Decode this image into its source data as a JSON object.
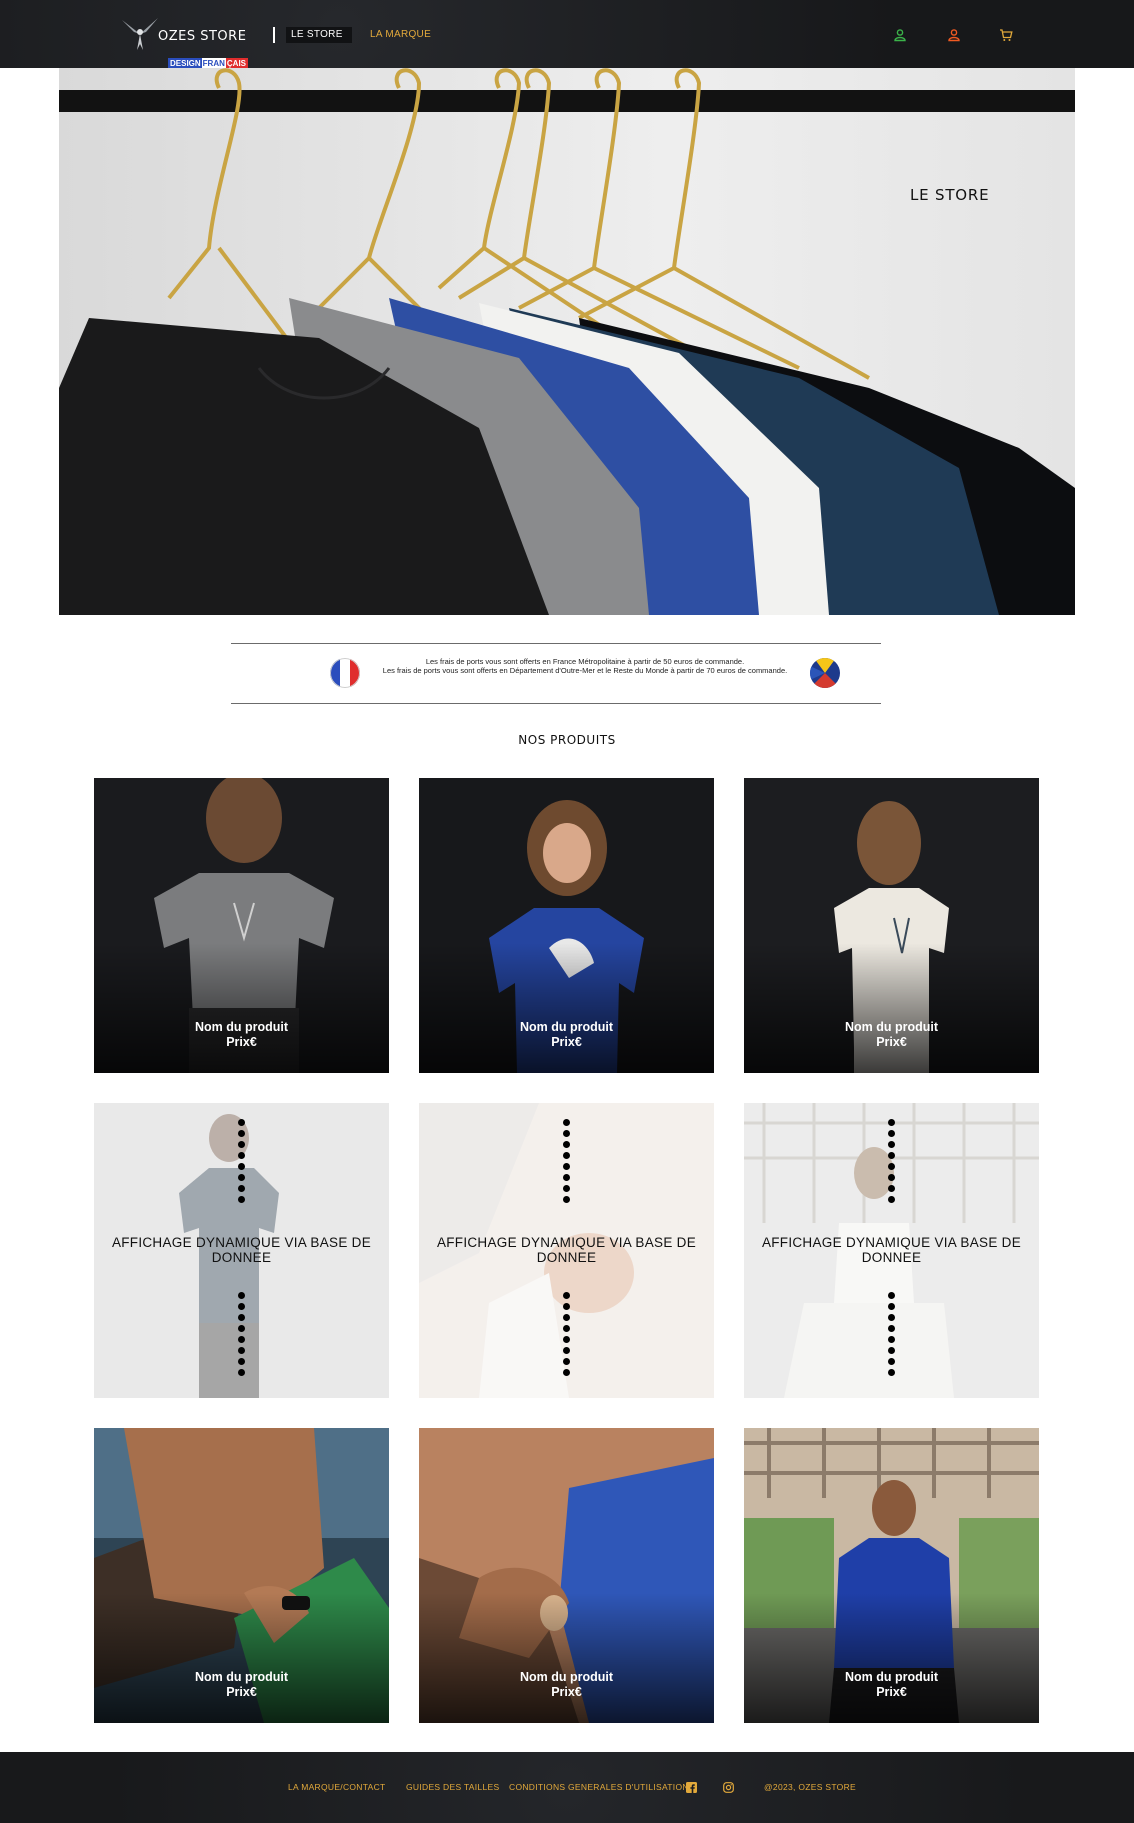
{
  "header": {
    "brand": "OZES STORE",
    "tagline": {
      "part1": "DESIGN",
      "part2": "FRAN",
      "part3": "ÇAIS"
    },
    "nav": {
      "store": "LE STORE",
      "marque": "LA MARQUE"
    },
    "icons": [
      "user-green-icon",
      "user-orange-icon",
      "cart-icon"
    ],
    "colors": {
      "accent": "#e2a93b",
      "user_green": "#3bb34a",
      "user_orange": "#f05a22",
      "background": "#1b1c1f"
    }
  },
  "hero": {
    "title": "LE STORE"
  },
  "shipping": {
    "line1": "Les frais de ports vous sont offerts en France Métropolitaine à partir de 50 euros de commande.",
    "line2": "Les frais de ports vous sont offerts en Département d'Outre-Mer et le Reste du Monde à partir de 70 euros de commande.",
    "flags": [
      "france-flag-icon",
      "reunion-flag-icon"
    ]
  },
  "products": {
    "title": "NOS PRODUITS",
    "cards": [
      {
        "name": "Nom du produit",
        "price": "Prix€"
      },
      {
        "name": "Nom du produit",
        "price": "Prix€"
      },
      {
        "name": "Nom du produit",
        "price": "Prix€"
      },
      {
        "dynamic": "AFFICHAGE DYNAMIQUE VIA BASE DE DONNEE"
      },
      {
        "dynamic": "AFFICHAGE DYNAMIQUE VIA BASE DE DONNEE"
      },
      {
        "dynamic": "AFFICHAGE DYNAMIQUE VIA BASE DE DONNEE"
      },
      {
        "name": "Nom du produit",
        "price": "Prix€"
      },
      {
        "name": "Nom du produit",
        "price": "Prix€"
      },
      {
        "name": "Nom du produit",
        "price": "Prix€"
      }
    ]
  },
  "footer": {
    "links": [
      "LA MARQUE/CONTACT",
      "GUIDES DES TAILLES",
      "CONDITIONS GENERALES D'UTILISATION"
    ],
    "social": [
      "facebook-icon",
      "instagram-icon"
    ],
    "copyright": "@2023, OZES STORE"
  }
}
